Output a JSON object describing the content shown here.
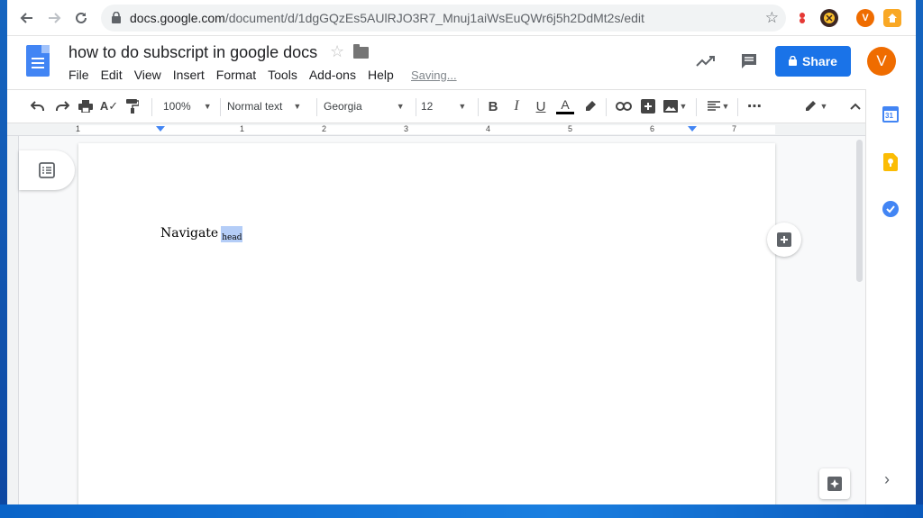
{
  "browser": {
    "url_host": "docs.google.com",
    "url_path": "/document/d/1dgGQzEs5AUlRJO3R7_Mnuj1aiWsEuQWr6j5h2DdMt2s/edit",
    "profile_initial": "V"
  },
  "doc": {
    "title": "how to do subscript in google docs",
    "saving_status": "Saving..."
  },
  "menu": [
    "File",
    "Edit",
    "View",
    "Insert",
    "Format",
    "Tools",
    "Add-ons",
    "Help"
  ],
  "header": {
    "share_label": "Share",
    "avatar_initial": "V"
  },
  "toolbar": {
    "zoom": "100%",
    "style": "Normal text",
    "font": "Georgia",
    "font_size": "12"
  },
  "ruler": {
    "numbers": [
      "1",
      "1",
      "2",
      "3",
      "4",
      "5",
      "6",
      "7"
    ]
  },
  "content": {
    "main_text": "Navigate",
    "subscript_text": "head"
  },
  "colors": {
    "accent": "#1a73e8",
    "avatar": "#ef6c00",
    "selection": "#b4cdf7"
  },
  "icons": {
    "calendar_day": "31"
  }
}
